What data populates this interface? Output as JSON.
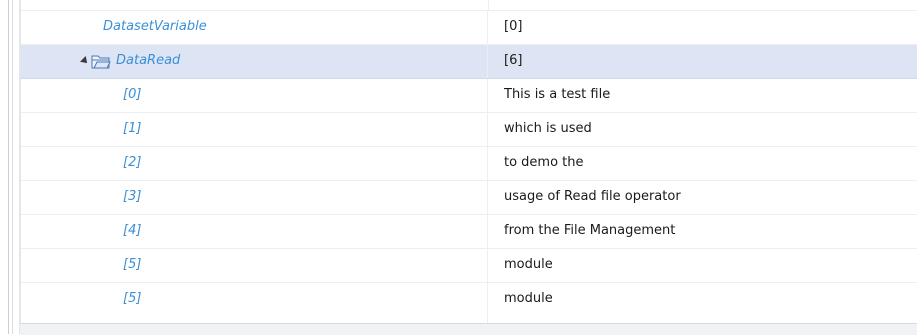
{
  "rows": [
    {
      "name": "DatasetVariable",
      "value": "[0]"
    },
    {
      "name": "DataRead",
      "value": "[6]"
    },
    {
      "name": "[0]",
      "value": "This is a test file"
    },
    {
      "name": "[1]",
      "value": "which is used"
    },
    {
      "name": "[2]",
      "value": "to demo the"
    },
    {
      "name": "[3]",
      "value": "usage of Read file operator"
    },
    {
      "name": "[4]",
      "value": "from the File Management"
    },
    {
      "name": "[5]",
      "value": "module"
    }
  ],
  "icons": {
    "expander": "collapse-triangle-icon",
    "folder": "folder-icon"
  },
  "colors": {
    "name_text": "#3a8fd6",
    "selected_row": "#dde4f3"
  }
}
